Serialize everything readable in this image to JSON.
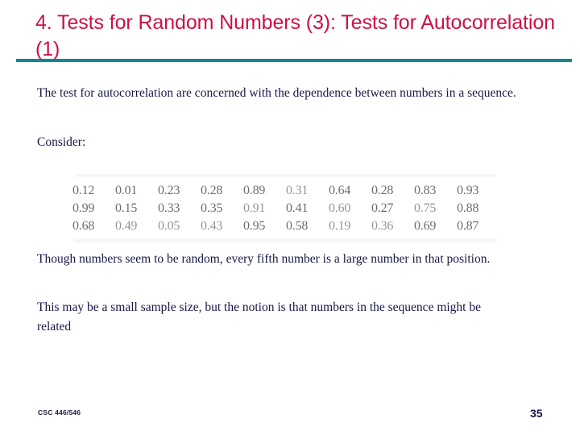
{
  "slide": {
    "title": "4. Tests for Random Numbers (3): Tests for Autocorrelation (1)",
    "page_number": "35",
    "course_footer": "CSC 446/546",
    "accent_title_color": "#CC1145",
    "accent_rule_color": "#11888D",
    "body_text_color": "#181848",
    "background_color": "#FFFFFF"
  },
  "body": {
    "intro": "The test for autocorrelation are concerned with the dependence between numbers in a sequence.",
    "consider": "Consider:",
    "observation": "Though numbers seem to be random, every fifth number is a large number in that position.",
    "conclusion": "This may be a small sample size, but the notion is that numbers in the sequence might be related"
  },
  "number_grid": {
    "columns": 10,
    "rows": [
      [
        "0.12",
        "0.01",
        "0.23",
        "0.28",
        "0.89",
        "0.31",
        "0.64",
        "0.28",
        "0.83",
        "0.93"
      ],
      [
        "0.99",
        "0.15",
        "0.33",
        "0.35",
        "0.91",
        "0.41",
        "0.60",
        "0.27",
        "0.75",
        "0.88"
      ],
      [
        "0.68",
        "0.49",
        "0.05",
        "0.43",
        "0.95",
        "0.58",
        "0.19",
        "0.36",
        "0.69",
        "0.87"
      ]
    ]
  }
}
